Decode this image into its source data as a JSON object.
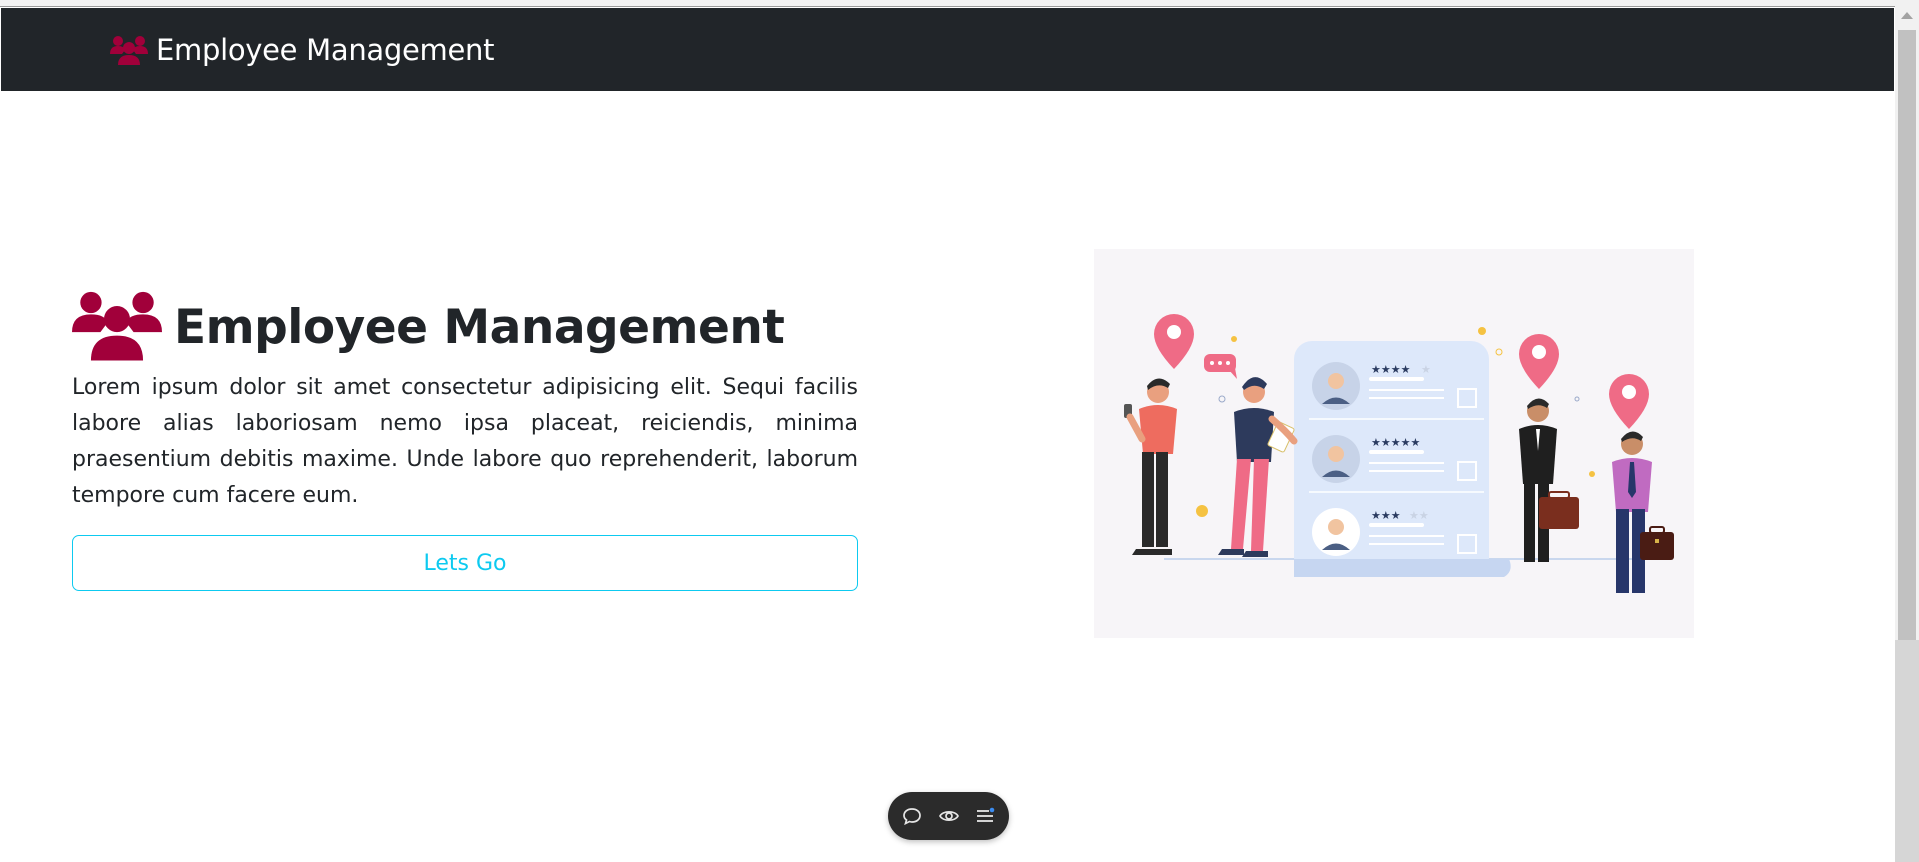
{
  "navbar": {
    "brand_icon": "users-icon",
    "brand_text": "Employee Management"
  },
  "hero": {
    "icon": "users-icon",
    "title": "Employee Management",
    "text": "Lorem ipsum dolor sit amet consectetur adipisicing elit. Sequi facilis labore alias laboriosam nemo ipsa placeat, reiciendis, minima praesentium debitis maxime. Unde labore quo reprehenderit, laborum tempore cum facere eum.",
    "button_label": "Lets Go"
  },
  "illustration": {
    "description_icon": "employee-ratings-illustration",
    "ratings": [
      4,
      5,
      3
    ]
  },
  "floating_toolbar": {
    "items": [
      "comment-icon",
      "eye-icon",
      "menu-icon"
    ]
  },
  "colors": {
    "navbar_bg": "#212529",
    "accent": "#a1003a",
    "button": "#0dcaf0",
    "text": "#212529"
  }
}
